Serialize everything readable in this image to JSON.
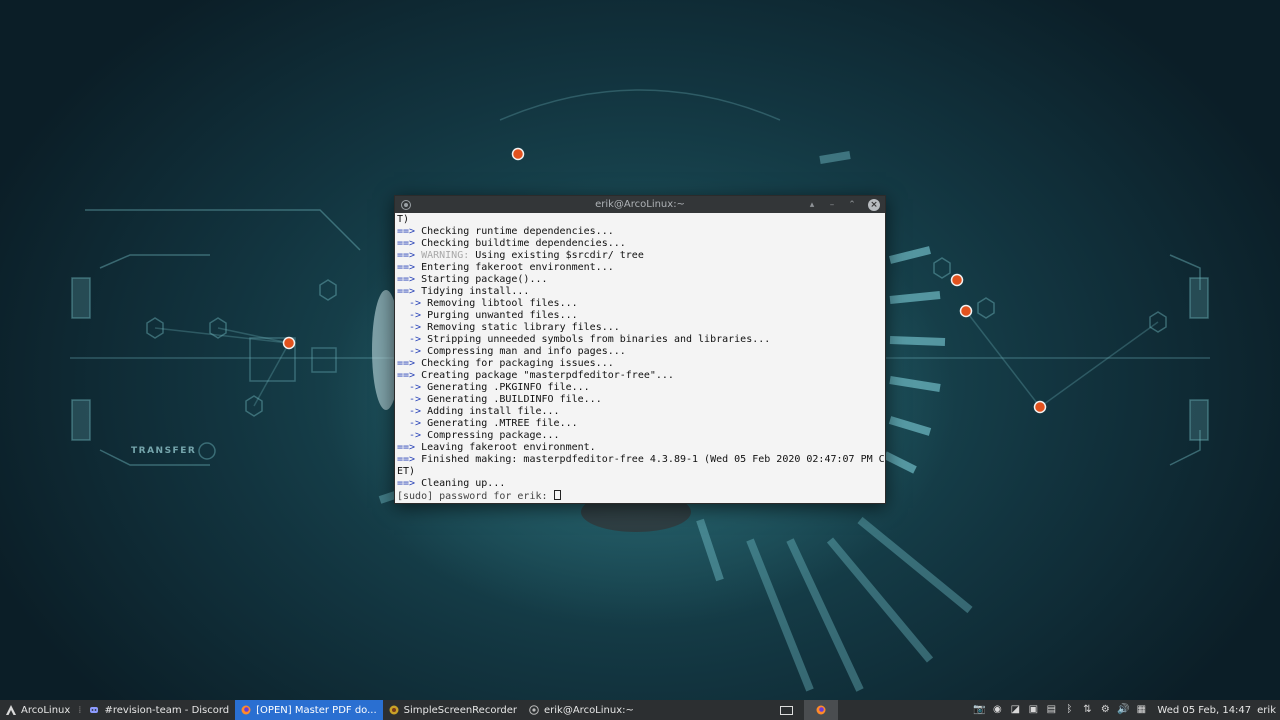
{
  "wallpaper": {
    "label": "TRANSFER"
  },
  "terminal": {
    "title": "erik@ArcoLinux:~",
    "lines": [
      {
        "prefix": "",
        "text": "T)"
      },
      {
        "prefix": "==>",
        "text": " Checking runtime dependencies..."
      },
      {
        "prefix": "==>",
        "text": " Checking buildtime dependencies..."
      },
      {
        "prefix": "==>",
        "warn": " WARNING:",
        "text": " Using existing $srcdir/ tree"
      },
      {
        "prefix": "==>",
        "text": " Entering fakeroot environment..."
      },
      {
        "prefix": "==>",
        "text": " Starting package()..."
      },
      {
        "prefix": "==>",
        "text": " Tidying install..."
      },
      {
        "prefix": "  ->",
        "text": " Removing libtool files..."
      },
      {
        "prefix": "  ->",
        "text": " Purging unwanted files..."
      },
      {
        "prefix": "  ->",
        "text": " Removing static library files..."
      },
      {
        "prefix": "  ->",
        "text": " Stripping unneeded symbols from binaries and libraries..."
      },
      {
        "prefix": "  ->",
        "text": " Compressing man and info pages..."
      },
      {
        "prefix": "==>",
        "text": " Checking for packaging issues..."
      },
      {
        "prefix": "==>",
        "text": " Creating package \"masterpdfeditor-free\"..."
      },
      {
        "prefix": "  ->",
        "text": " Generating .PKGINFO file..."
      },
      {
        "prefix": "  ->",
        "text": " Generating .BUILDINFO file..."
      },
      {
        "prefix": "  ->",
        "text": " Adding install file..."
      },
      {
        "prefix": "  ->",
        "text": " Generating .MTREE file..."
      },
      {
        "prefix": "  ->",
        "text": " Compressing package..."
      },
      {
        "prefix": "==>",
        "text": " Leaving fakeroot environment."
      },
      {
        "prefix": "==>",
        "text": " Finished making: masterpdfeditor-free 4.3.89-1 (Wed 05 Feb 2020 02:47:07 PM C"
      },
      {
        "prefix": "",
        "text": "ET)"
      },
      {
        "prefix": "==>",
        "text": " Cleaning up..."
      }
    ],
    "prompt": "[sudo] password for erik: "
  },
  "taskbar": {
    "start_label": "ArcoLinux",
    "items": [
      {
        "label": "#revision-team - Discord",
        "icon": "discord-icon",
        "active": false
      },
      {
        "label": "[OPEN] Master PDF do...",
        "icon": "firefox-icon",
        "active": true
      },
      {
        "label": "SimpleScreenRecorder",
        "icon": "recorder-icon",
        "active": false
      },
      {
        "label": "erik@ArcoLinux:~",
        "icon": "terminal-icon",
        "active": false
      }
    ],
    "clock": "Wed 05 Feb, 14:47",
    "user": "erik",
    "accent": "#2a6fd1"
  }
}
